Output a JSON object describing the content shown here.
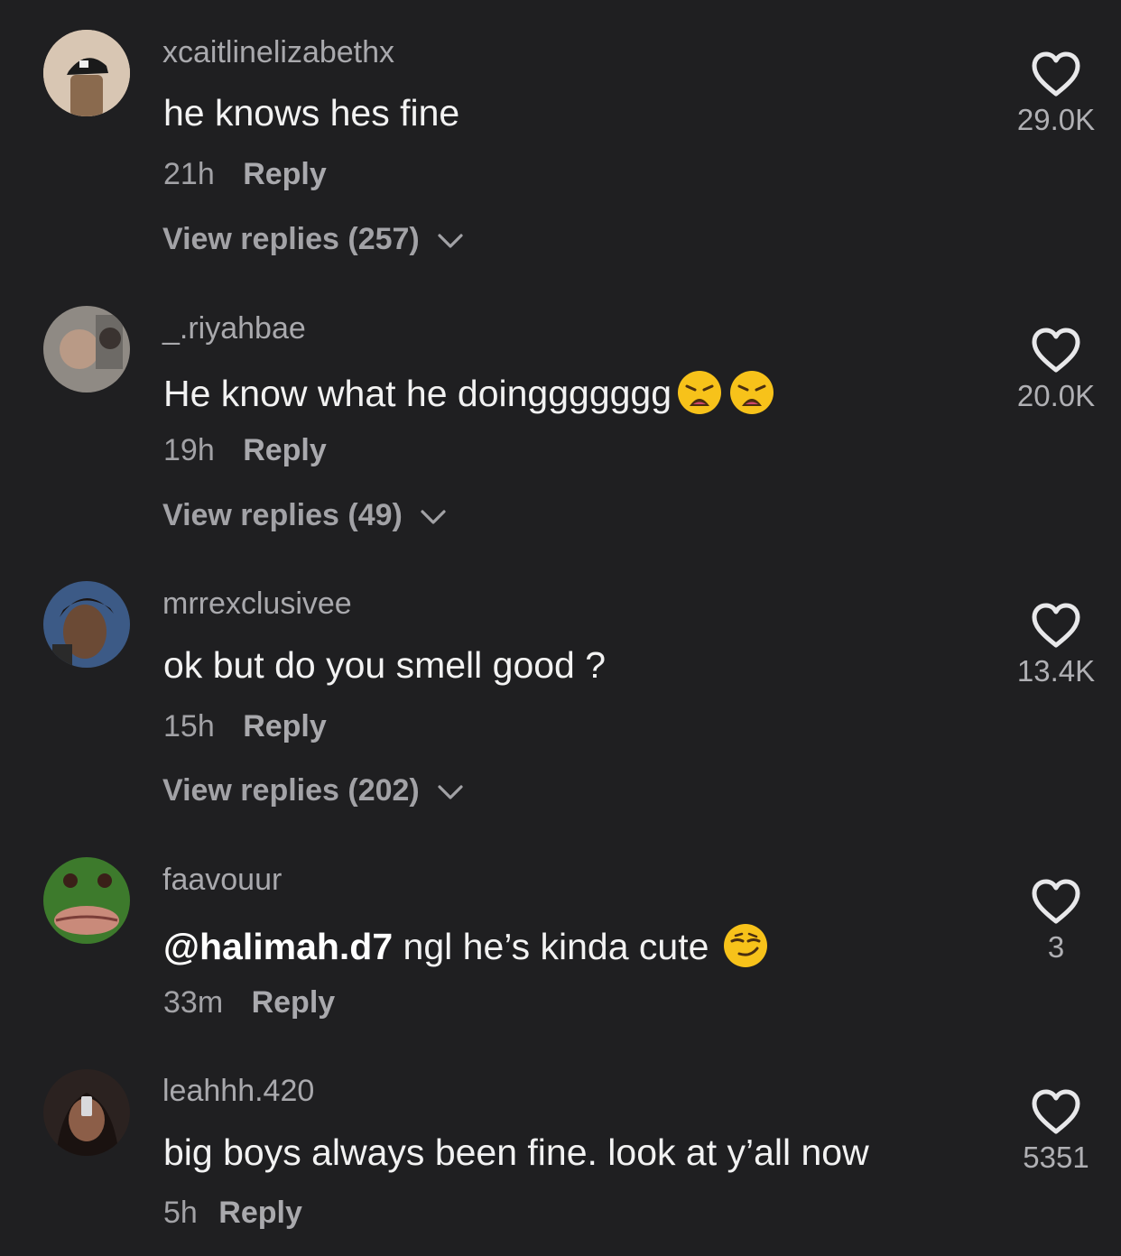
{
  "comments": [
    {
      "username": "xcaitlinelizabethx",
      "text": "he knows hes fine",
      "time": "21h",
      "reply_label": "Reply",
      "view_replies": "View replies (257)",
      "likes": "29.0K"
    },
    {
      "username": "_.riyahbae",
      "text": "He know what he doinggggggg",
      "emojis": [
        "weary-face",
        "weary-face"
      ],
      "time": "19h",
      "reply_label": "Reply",
      "view_replies": "View replies (49)",
      "likes": "20.0K"
    },
    {
      "username": "mrrexclusivee",
      "text": "ok but do you smell good ?",
      "time": "15h",
      "reply_label": "Reply",
      "view_replies": "View replies (202)",
      "likes": "13.4K"
    },
    {
      "username": "faavouur",
      "mention": "@halimah.d7",
      "text": " ngl he’s kinda cute",
      "emojis": [
        "smirking-face"
      ],
      "time": "33m",
      "reply_label": "Reply",
      "likes": "3"
    },
    {
      "username": "leahhh.420",
      "text": "big boys always been fine. look at y’all now",
      "time": "5h",
      "reply_label": "Reply",
      "likes": "5351"
    }
  ],
  "colors": {
    "background": "#1f1f21",
    "primary_text": "#f2f2f2",
    "secondary_text": "#a2a2a6",
    "emoji_yellow": "#f7c21a"
  }
}
